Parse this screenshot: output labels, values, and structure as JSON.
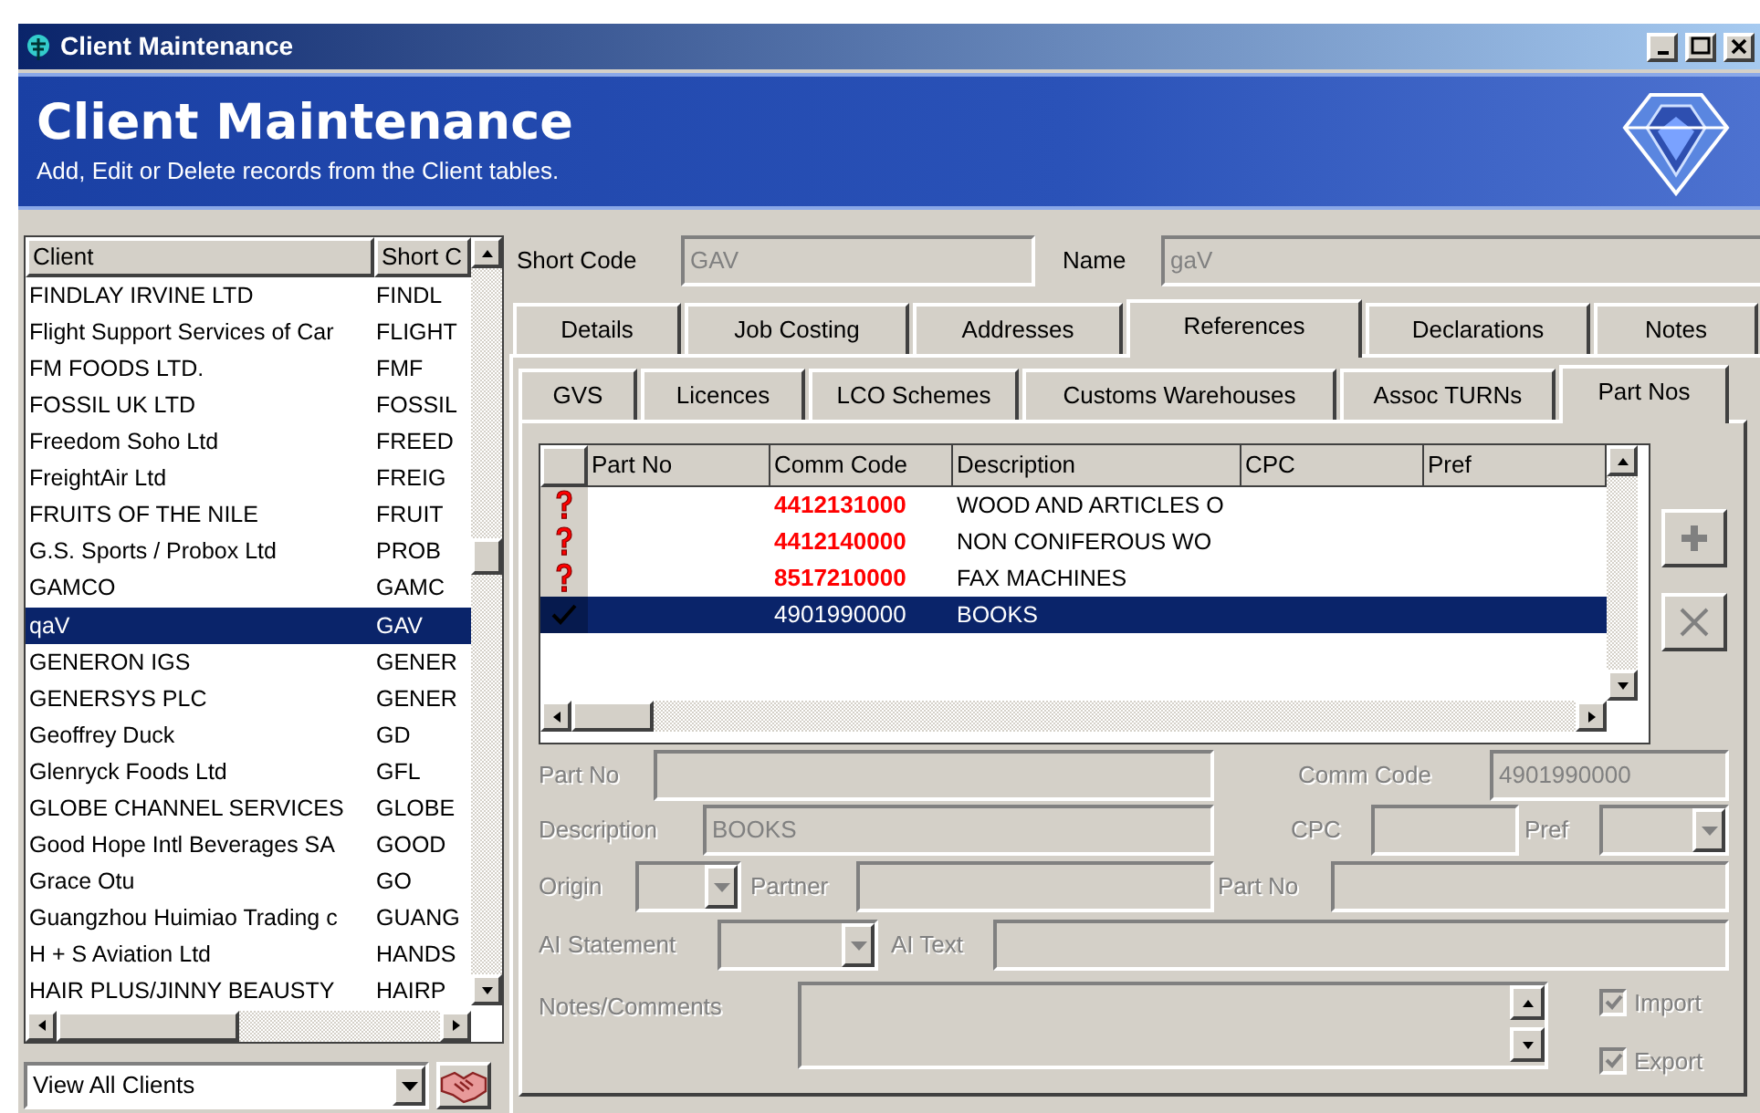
{
  "window": {
    "title": "Client Maintenance"
  },
  "header": {
    "title": "Client Maintenance",
    "subtitle": "Add, Edit or Delete records from the Client tables."
  },
  "client_list": {
    "columns": [
      "Client",
      "Short C"
    ],
    "rows": [
      {
        "client": "FINDLAY IRVINE LTD",
        "short_code": "FINDL",
        "selected": false
      },
      {
        "client": "Flight Support Services of Car",
        "short_code": "FLIGHT",
        "selected": false
      },
      {
        "client": "FM FOODS LTD.",
        "short_code": "FMF",
        "selected": false
      },
      {
        "client": "FOSSIL UK LTD",
        "short_code": "FOSSIL",
        "selected": false
      },
      {
        "client": "Freedom Soho Ltd",
        "short_code": "FREED",
        "selected": false
      },
      {
        "client": "FreightAir Ltd",
        "short_code": "FREIG",
        "selected": false
      },
      {
        "client": "FRUITS OF THE NILE",
        "short_code": "FRUIT",
        "selected": false
      },
      {
        "client": "G.S. Sports / Probox Ltd",
        "short_code": "PROB",
        "selected": false
      },
      {
        "client": "GAMCO",
        "short_code": "GAMC",
        "selected": false
      },
      {
        "client": "qaV",
        "short_code": "GAV",
        "selected": true
      },
      {
        "client": "GENERON IGS",
        "short_code": "GENER",
        "selected": false
      },
      {
        "client": "GENERSYS PLC",
        "short_code": "GENER",
        "selected": false
      },
      {
        "client": "Geoffrey Duck",
        "short_code": "GD",
        "selected": false
      },
      {
        "client": "Glenryck Foods Ltd",
        "short_code": "GFL",
        "selected": false
      },
      {
        "client": "GLOBE CHANNEL SERVICES",
        "short_code": "GLOBE",
        "selected": false
      },
      {
        "client": "Good Hope Intl Beverages SA",
        "short_code": "GOOD",
        "selected": false
      },
      {
        "client": "Grace Otu",
        "short_code": "GO",
        "selected": false
      },
      {
        "client": "Guangzhou Huimiao Trading c",
        "short_code": "GUANG",
        "selected": false
      },
      {
        "client": "H + S Aviation Ltd",
        "short_code": "HANDS",
        "selected": false
      },
      {
        "client": "HAIR PLUS/JINNY BEAUSTY",
        "short_code": "HAIRP",
        "selected": false
      }
    ],
    "filter": {
      "value": "View All Clients"
    }
  },
  "record": {
    "short_code_label": "Short Code",
    "short_code": "GAV",
    "name_label": "Name",
    "name": "gaV"
  },
  "tabs": [
    {
      "label": "Details",
      "selected": false
    },
    {
      "label": "Job Costing",
      "selected": false
    },
    {
      "label": "Addresses",
      "selected": false
    },
    {
      "label": "References",
      "selected": true
    },
    {
      "label": "Declarations",
      "selected": false
    },
    {
      "label": "Notes",
      "selected": false
    }
  ],
  "subtabs": [
    {
      "label": "GVS",
      "selected": false
    },
    {
      "label": "Licences",
      "selected": false
    },
    {
      "label": "LCO Schemes",
      "selected": false
    },
    {
      "label": "Customs Warehouses",
      "selected": false
    },
    {
      "label": "Assoc TURNs",
      "selected": false
    },
    {
      "label": "Part Nos",
      "selected": true
    }
  ],
  "parts_grid": {
    "columns": [
      "Part No",
      "Comm Code",
      "Description",
      "CPC",
      "Pref"
    ],
    "rows": [
      {
        "kind": "unverified",
        "comm_code": "4412131000",
        "description": "WOOD AND ARTICLES O",
        "selected": false
      },
      {
        "kind": "unverified",
        "comm_code": "4412140000",
        "description": "NON CONIFEROUS WO",
        "selected": false
      },
      {
        "kind": "unverified",
        "comm_code": "8517210000",
        "description": "FAX MACHINES",
        "selected": false
      },
      {
        "kind": "verified",
        "comm_code": "4901990000",
        "description": "BOOKS",
        "selected": true
      }
    ]
  },
  "form": {
    "disabled": true,
    "part_no_label": "Part No",
    "comm_code_label": "Comm Code",
    "comm_code": "4901990000",
    "description_label": "Description",
    "description": "BOOKS",
    "cpc_label": "CPC",
    "pref_label": "Pref",
    "origin_label": "Origin",
    "partner_label": "Partner",
    "partner_part_no_label": "Part No",
    "ai_statement_label": "AI Statement",
    "ai_text_label": "AI Text",
    "notes_label": "Notes/Comments",
    "checkboxes": [
      {
        "label": "Import",
        "checked": true
      },
      {
        "label": "Export",
        "checked": true
      }
    ]
  }
}
